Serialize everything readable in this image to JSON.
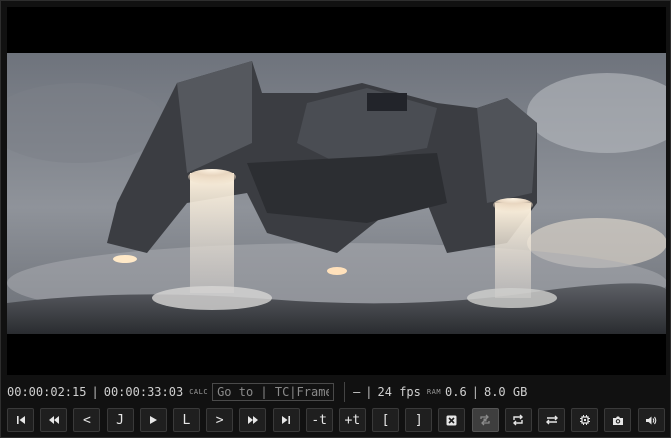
{
  "viewer": {
    "image_description_icon": "video-frame"
  },
  "status": {
    "current_tc": "00:00:02:15",
    "separator": "|",
    "duration_tc": "00:00:33:03",
    "calc_label": "CALC",
    "goto_placeholder": "Go to | TC|Frame",
    "dash": "–",
    "fps": "24 fps",
    "ram_label": "RAM",
    "ram_value": "0.6",
    "ram_sep": "|",
    "ram_total": "8.0 GB"
  },
  "controls": {
    "prev_frame_start": "⏮",
    "rewind": "«",
    "step_back": "<",
    "j_label": "J",
    "play": "▶",
    "l_label": "L",
    "step_forward": ">",
    "fast_forward": "»",
    "next_end": "⏭",
    "minus_t": "-t",
    "plus_t": "+t",
    "mark_in": "[",
    "mark_out": "]"
  },
  "colors": {
    "background": "#111111",
    "button": "#1f1f1f",
    "active_button": "#3e3e3e",
    "text": "#d0d0d0"
  }
}
